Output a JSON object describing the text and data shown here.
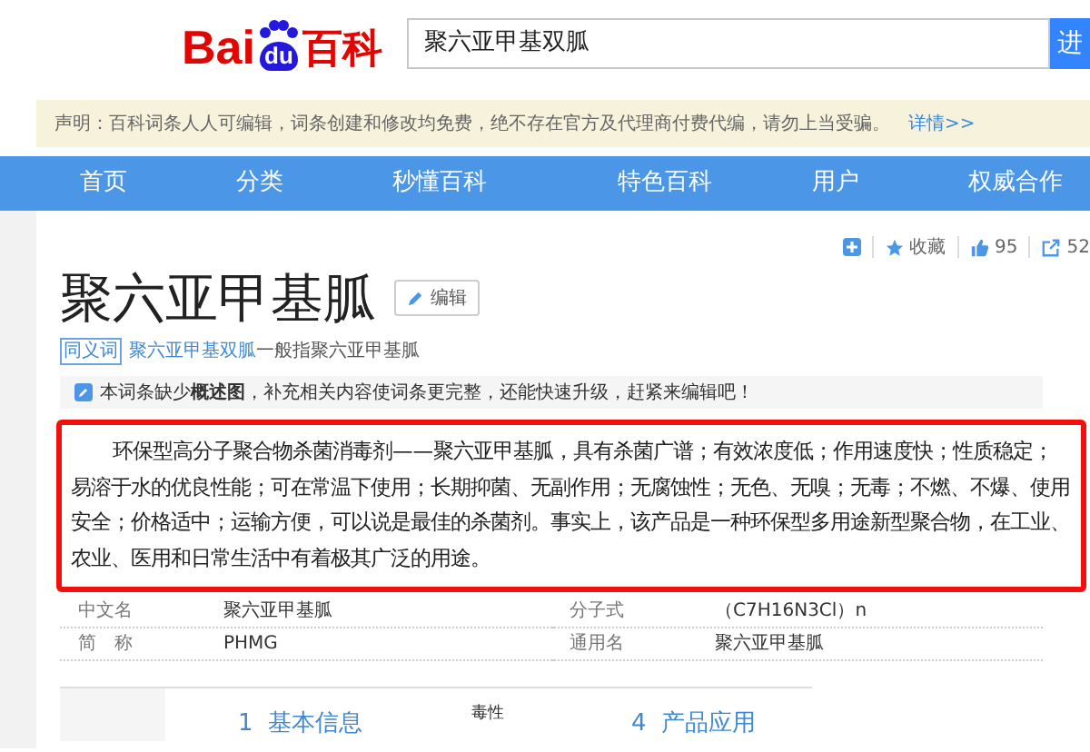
{
  "logo": {
    "part_1": "Bai",
    "part_2": "du",
    "part_3": "百科"
  },
  "search": {
    "value": "聚六亚甲基双胍",
    "button": "进"
  },
  "notice": {
    "text": "声明：百科词条人人可编辑，词条创建和修改均免费，绝不存在官方及代理商付费代编，请勿上当受骗。",
    "link": "详情>>"
  },
  "nav": [
    {
      "label": "首页"
    },
    {
      "label": "分类"
    },
    {
      "label": "秒懂百科"
    },
    {
      "label": "特色百科"
    },
    {
      "label": "用户"
    },
    {
      "label": "权威合作"
    }
  ],
  "actions": {
    "collect": "收藏",
    "likes": "95",
    "shares": "52"
  },
  "title": "聚六亚甲基胍",
  "edit_button": "编辑",
  "synonym": {
    "tag": "同义词",
    "link": "聚六亚甲基双胍",
    "text": "一般指聚六亚甲基胍"
  },
  "tip": "本词条缺少**概述图**，补充相关内容使词条更完整，还能快速升级，赶紧来编辑吧！",
  "summary": "环保型高分子聚合物杀菌消毒剂——聚六亚甲基胍，具有杀菌广谱；有效浓度低；作用速度快；性质稳定；易溶于水的优良性能；可在常温下使用；长期抑菌、无副作用；无腐蚀性；无色、无嗅；无毒；不燃、不爆、使用安全；价格适中；运输方便，可以说是最佳的杀菌剂。事实上，该产品是一种环保型多用途新型聚合物，在工业、农业、医用和日常生活中有着极其广泛的用途。",
  "infobox": [
    {
      "label": "中文名",
      "value": "聚六亚甲基胍"
    },
    {
      "label": "分子式",
      "value": "（C7H16N3Cl）n"
    },
    {
      "label": "简　称",
      "value": "PHMG"
    },
    {
      "label": "通用名",
      "value": "聚六亚甲基胍"
    }
  ],
  "catalog": [
    {
      "label": "1  基本信息"
    },
    {
      "label": "毒性"
    },
    {
      "label": "4  产品应用"
    }
  ]
}
